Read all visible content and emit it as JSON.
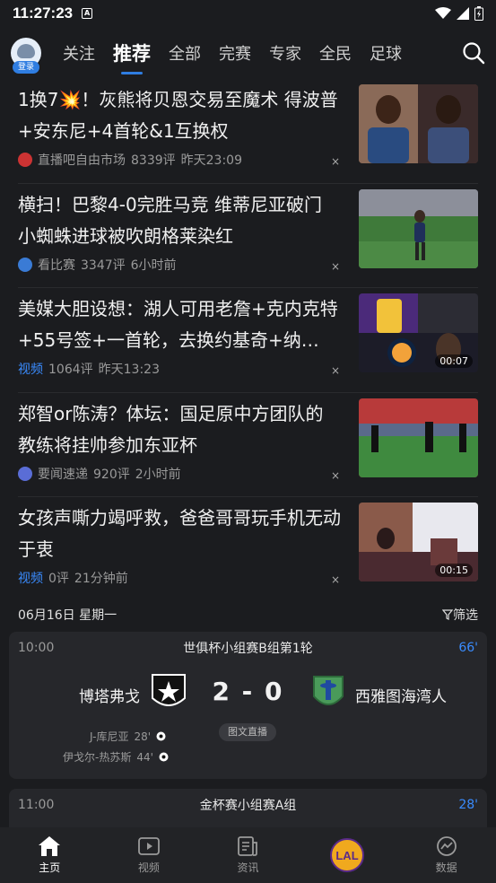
{
  "status": {
    "time": "11:27:23",
    "a_badge": "A"
  },
  "header": {
    "login_label": "登录",
    "tabs": [
      {
        "label": "关注",
        "active": false
      },
      {
        "label": "推荐",
        "active": true
      },
      {
        "label": "全部",
        "active": false
      },
      {
        "label": "完赛",
        "active": false
      },
      {
        "label": "专家",
        "active": false
      },
      {
        "label": "全民",
        "active": false
      },
      {
        "label": "足球",
        "active": false
      }
    ]
  },
  "news": [
    {
      "title": "1换7💥！灰熊将贝恩交易至魔术 得波普+安东尼+4首轮&1互换权",
      "source": "直播吧自由市场",
      "comments": "8339评",
      "time": "昨天23:09",
      "is_video": false,
      "duration": ""
    },
    {
      "title": "横扫！巴黎4-0完胜马竞 维蒂尼亚破门 小蜘蛛进球被吹朗格莱染红",
      "source": "看比赛",
      "comments": "3347评",
      "time": "6小时前",
      "is_video": false,
      "duration": ""
    },
    {
      "title": "美媒大胆设想：湖人可用老詹+克内克特+55号签+一首轮，去换约基奇+纳…",
      "source": "视频",
      "comments": "1064评",
      "time": "昨天13:23",
      "is_video": true,
      "duration": "00:07"
    },
    {
      "title": "郑智or陈涛？体坛：国足原中方团队的教练将挂帅参加东亚杯",
      "source": "要闻速递",
      "comments": "920评",
      "time": "2小时前",
      "is_video": false,
      "duration": ""
    },
    {
      "title": "女孩声嘶力竭呼救，爸爸哥哥玩手机无动于衷",
      "source": "视频",
      "comments": "0评",
      "time": "21分钟前",
      "is_video": true,
      "duration": "00:15"
    }
  ],
  "close_glyph": "×",
  "schedule": {
    "date": "06月16日 星期一",
    "filter_label": "筛选",
    "matches": [
      {
        "time": "10:00",
        "league": "世俱杯小组赛B组第1轮",
        "minute": "66'",
        "home": "博塔弗戈",
        "away": "西雅图海湾人",
        "score": "2 - 0",
        "live_label": "图文直播",
        "scorers": [
          {
            "name": "J-库尼亚",
            "minute": "28'"
          },
          {
            "name": "伊戈尔-热苏斯",
            "minute": "44'"
          }
        ]
      },
      {
        "time": "11:00",
        "league": "金杯赛小组赛A组",
        "minute": "28'"
      }
    ]
  },
  "bottom_nav": [
    {
      "label": "主页",
      "icon": "home-icon",
      "active": true
    },
    {
      "label": "视频",
      "icon": "video-icon",
      "active": false
    },
    {
      "label": "资讯",
      "icon": "news-icon",
      "active": false
    },
    {
      "label": "LAL",
      "icon": "lakers-logo",
      "active": false
    },
    {
      "label": "数据",
      "icon": "data-icon",
      "active": false
    }
  ],
  "colors": {
    "accent": "#2f7de1",
    "link": "#3a8cff",
    "background": "#1b1c1f",
    "card": "#26272b"
  }
}
